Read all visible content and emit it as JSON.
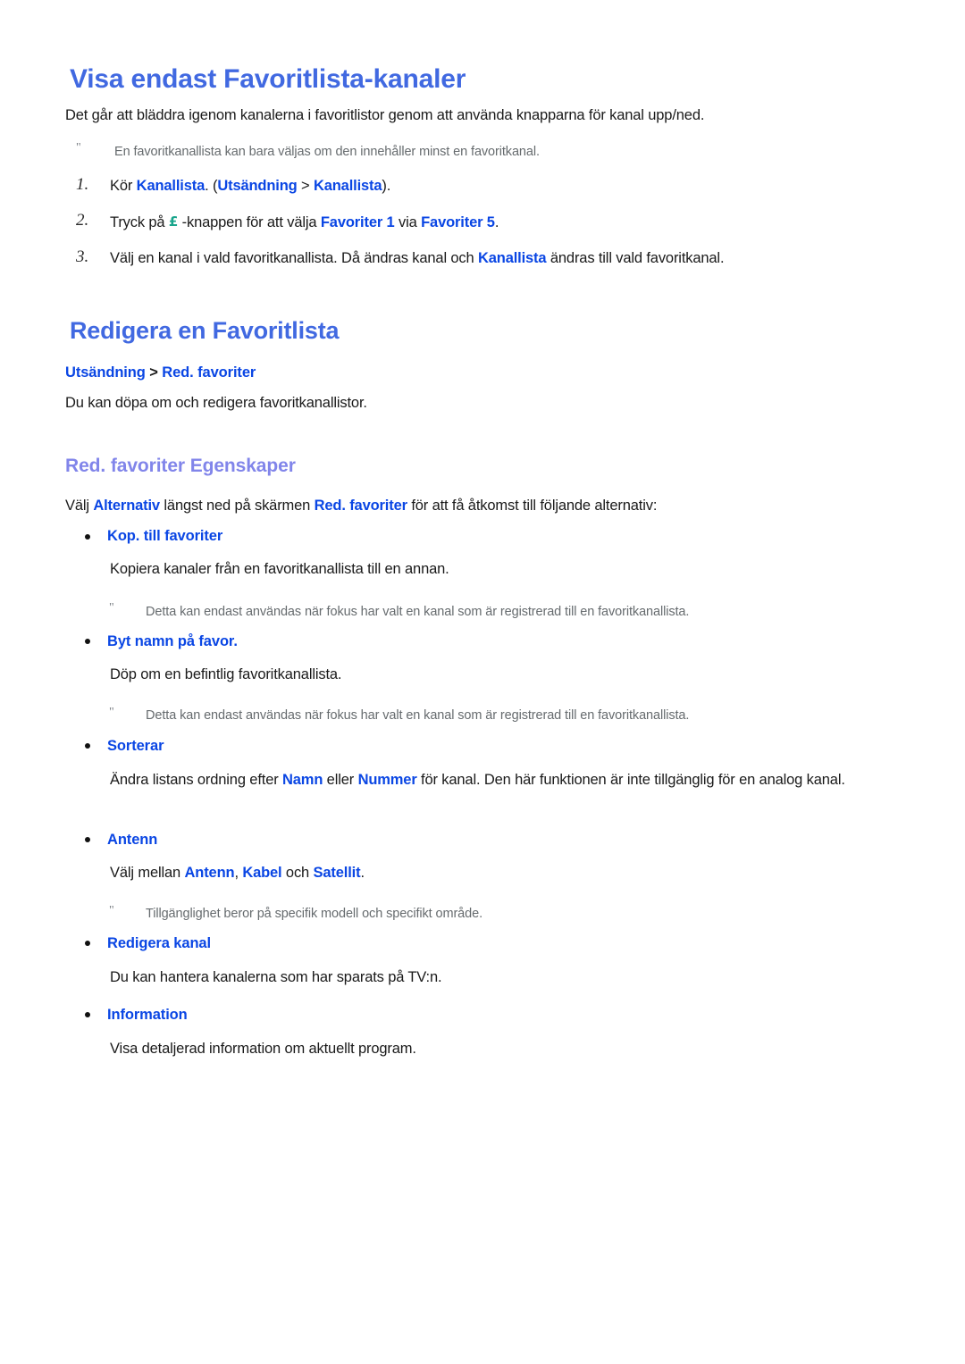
{
  "document": {
    "section1": {
      "heading": "Visa endast Favoritlista-kanaler",
      "intro": "Det går att bläddra igenom kanalerna i favoritlistor genom att använda knapparna för kanal upp/ned.",
      "note": "En favoritkanallista kan bara väljas om den innehåller minst en favoritkanal.",
      "note_marker": "\"",
      "steps": [
        {
          "number": "1.",
          "parts": [
            {
              "text": "Kör ",
              "style": "plain"
            },
            {
              "text": "Kanallista",
              "style": "blue"
            },
            {
              "text": ". (",
              "style": "plain"
            },
            {
              "text": "Utsändning",
              "style": "blue"
            },
            {
              "text": " > ",
              "style": "plain"
            },
            {
              "text": "Kanallista",
              "style": "blue"
            },
            {
              "text": ").",
              "style": "plain"
            }
          ]
        },
        {
          "number": "2.",
          "parts": [
            {
              "text": "Tryck på ",
              "style": "plain"
            },
            {
              "text": "£",
              "style": "remote-key"
            },
            {
              "text": " -knappen för att välja ",
              "style": "plain"
            },
            {
              "text": "Favoriter 1",
              "style": "blue"
            },
            {
              "text": " via ",
              "style": "plain"
            },
            {
              "text": "Favoriter 5",
              "style": "blue"
            },
            {
              "text": ".",
              "style": "plain"
            }
          ]
        },
        {
          "number": "3.",
          "parts": [
            {
              "text": "Välj en kanal i vald favoritkanallista. Då ändras kanal och ",
              "style": "plain"
            },
            {
              "text": "Kanallista",
              "style": "blue"
            },
            {
              "text": " ändras till vald favoritkanal.",
              "style": "plain"
            }
          ]
        }
      ]
    },
    "section2": {
      "heading": "Redigera en Favoritlista",
      "breadcrumb": {
        "first": "Utsändning",
        "separator": " > ",
        "second": "Red. favoriter"
      },
      "intro": "Du kan döpa om och redigera favoritkanallistor.",
      "subheading": "Red. favoriter Egenskaper",
      "lead_parts": [
        {
          "text": "Välj ",
          "style": "plain"
        },
        {
          "text": "Alternativ",
          "style": "blue"
        },
        {
          "text": " längst ned på skärmen ",
          "style": "plain"
        },
        {
          "text": "Red. favoriter",
          "style": "blue"
        },
        {
          "text": " för att få åtkomst till följande alternativ:",
          "style": "plain"
        }
      ],
      "options": [
        {
          "label": "Kop. till favoriter",
          "description_parts": [
            {
              "text": "Kopiera kanaler från en favoritkanallista till en annan.",
              "style": "plain"
            }
          ],
          "note": "Detta kan endast användas när fokus har valt en kanal som är registrerad till en favoritkanallista.",
          "note_marker": "\""
        },
        {
          "label": "Byt namn på favor.",
          "description_parts": [
            {
              "text": "Döp om en befintlig favoritkanallista.",
              "style": "plain"
            }
          ],
          "note": "Detta kan endast användas när fokus har valt en kanal som är registrerad till en favoritkanallista.",
          "note_marker": "\""
        },
        {
          "label": "Sorterar",
          "description_parts": [
            {
              "text": "Ändra listans ordning efter ",
              "style": "plain"
            },
            {
              "text": "Namn",
              "style": "blue"
            },
            {
              "text": " eller ",
              "style": "plain"
            },
            {
              "text": "Nummer",
              "style": "blue"
            },
            {
              "text": " för kanal. Den här funktionen är inte tillgänglig för en analog kanal.",
              "style": "plain"
            }
          ],
          "note": null,
          "note_marker": null
        },
        {
          "label": "Antenn",
          "description_parts": [
            {
              "text": "Välj mellan ",
              "style": "plain"
            },
            {
              "text": "Antenn",
              "style": "blue"
            },
            {
              "text": ", ",
              "style": "plain"
            },
            {
              "text": "Kabel",
              "style": "blue"
            },
            {
              "text": " och ",
              "style": "plain"
            },
            {
              "text": "Satellit",
              "style": "blue"
            },
            {
              "text": ".",
              "style": "plain"
            }
          ],
          "note": "Tillgänglighet beror på specifik modell och specifikt område.",
          "note_marker": "\""
        },
        {
          "label": "Redigera kanal",
          "description_parts": [
            {
              "text": "Du kan hantera kanalerna som har sparats på TV:n.",
              "style": "plain"
            }
          ],
          "note": null,
          "note_marker": null
        },
        {
          "label": "Information",
          "description_parts": [
            {
              "text": "Visa detaljerad information om aktuellt program.",
              "style": "plain"
            }
          ],
          "note": null,
          "note_marker": null
        }
      ]
    }
  },
  "colors": {
    "heading_blue": "#4169e1",
    "inline_blue": "#0a46e4",
    "subheading_purple": "#8185ea",
    "note_gray": "#666b6e",
    "remote_key_teal": "#19a58c",
    "body_black": "#1a1a1a"
  }
}
